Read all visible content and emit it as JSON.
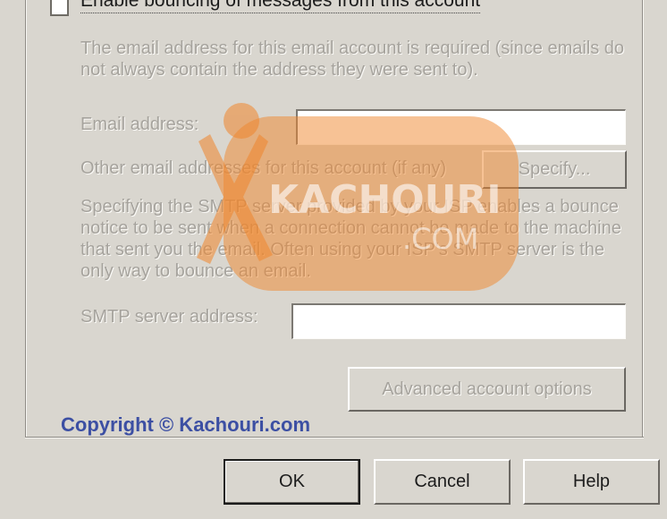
{
  "account": {
    "bounce_checkbox_label": "Enable bouncing of messages from this account",
    "bounce_checkbox_checked": false,
    "description": "The email address for this email account is required (since emails do not always contain the address they were sent to).",
    "email_label": "Email address:",
    "email_value": "",
    "other_addresses_label": "Other email addresses for this account (if any)",
    "specify_label": "Specify...",
    "smtp_description": "Specifying the SMTP server provided by your ISP enables a bounce notice to be sent when a connection cannot be made to the machine that sent you the email. Often using your ISP's SMTP server is the only way to bounce an email.",
    "smtp_label": "SMTP server address:",
    "smtp_value": "",
    "advanced_label": "Advanced account options"
  },
  "watermark": {
    "logo_text": "KACHOURI",
    "logo_subtext": ".COM",
    "copyright": "Copyright © Kachouri.com",
    "logo_color": "#f0862c"
  },
  "dialog_buttons": {
    "ok": "OK",
    "cancel": "Cancel",
    "help": "Help"
  }
}
